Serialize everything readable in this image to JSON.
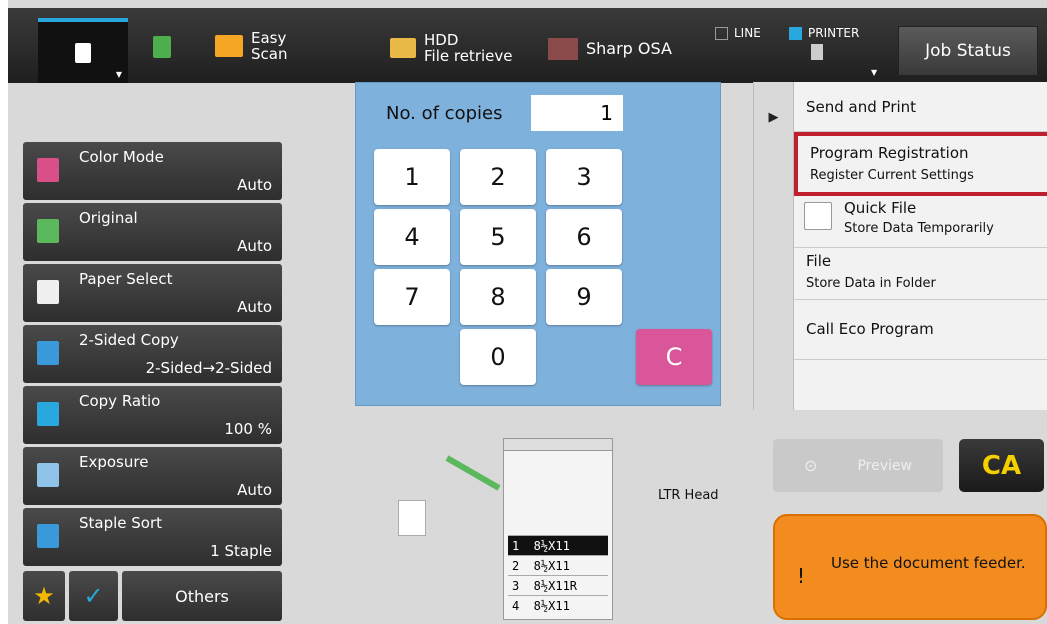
{
  "topbar": {
    "easy_scan": "Easy\nScan",
    "hdd": "HDD\nFile retrieve",
    "osa": "Sharp OSA",
    "line": "LINE",
    "printer": "PRINTER",
    "job_status": "Job Status"
  },
  "settings": [
    {
      "label": "Color Mode",
      "value": "Auto",
      "icon": "color-mode-icon",
      "color": "#d94f8a"
    },
    {
      "label": "Original",
      "value": "Auto",
      "icon": "original-icon",
      "color": "#5cb85c"
    },
    {
      "label": "Paper Select",
      "value": "Auto",
      "icon": "paper-select-icon",
      "color": "#f0f0f0"
    },
    {
      "label": "2-Sided Copy",
      "value": "2-Sided→2-Sided",
      "icon": "two-sided-icon",
      "color": "#3a9ad9"
    },
    {
      "label": "Copy Ratio",
      "value": "100 %",
      "icon": "copy-ratio-icon",
      "color": "#29a8e0"
    },
    {
      "label": "Exposure",
      "value": "Auto",
      "icon": "exposure-icon",
      "color": "#8fc3e8"
    },
    {
      "label": "Staple Sort",
      "value": "1 Staple",
      "icon": "staple-sort-icon",
      "color": "#3a9ad9"
    }
  ],
  "bottom": {
    "star": "★",
    "check": "✓",
    "others": "Others"
  },
  "copies": {
    "label": "No. of copies",
    "value": "1"
  },
  "keys": [
    "1",
    "2",
    "3",
    "4",
    "5",
    "6",
    "7",
    "8",
    "9",
    "0",
    "C"
  ],
  "panel": {
    "arrow": "▶",
    "send_print": "Send and Print",
    "prog_reg": "Program Registration",
    "prog_reg_sub": "Register Current Settings",
    "quick_file": "Quick File",
    "quick_file_sub": "Store Data Temporarily",
    "file": "File",
    "file_sub": "Store Data in Folder",
    "eco": "Call Eco Program"
  },
  "machine": {
    "cassettes": [
      "1  8½X11",
      "2  8½X11",
      "3  8½X11R",
      "4  8½X11"
    ],
    "ltr_head": "LTR Head"
  },
  "preview": "Preview",
  "ca": "CA",
  "message": {
    "icon": "!",
    "text": "Use the document feeder."
  },
  "colors": {
    "accent": "#29a8e0",
    "keypad": "#7fb1dd",
    "clear": "#d9569a",
    "warning": "#f28c1e",
    "highlight": "#c0202e"
  }
}
